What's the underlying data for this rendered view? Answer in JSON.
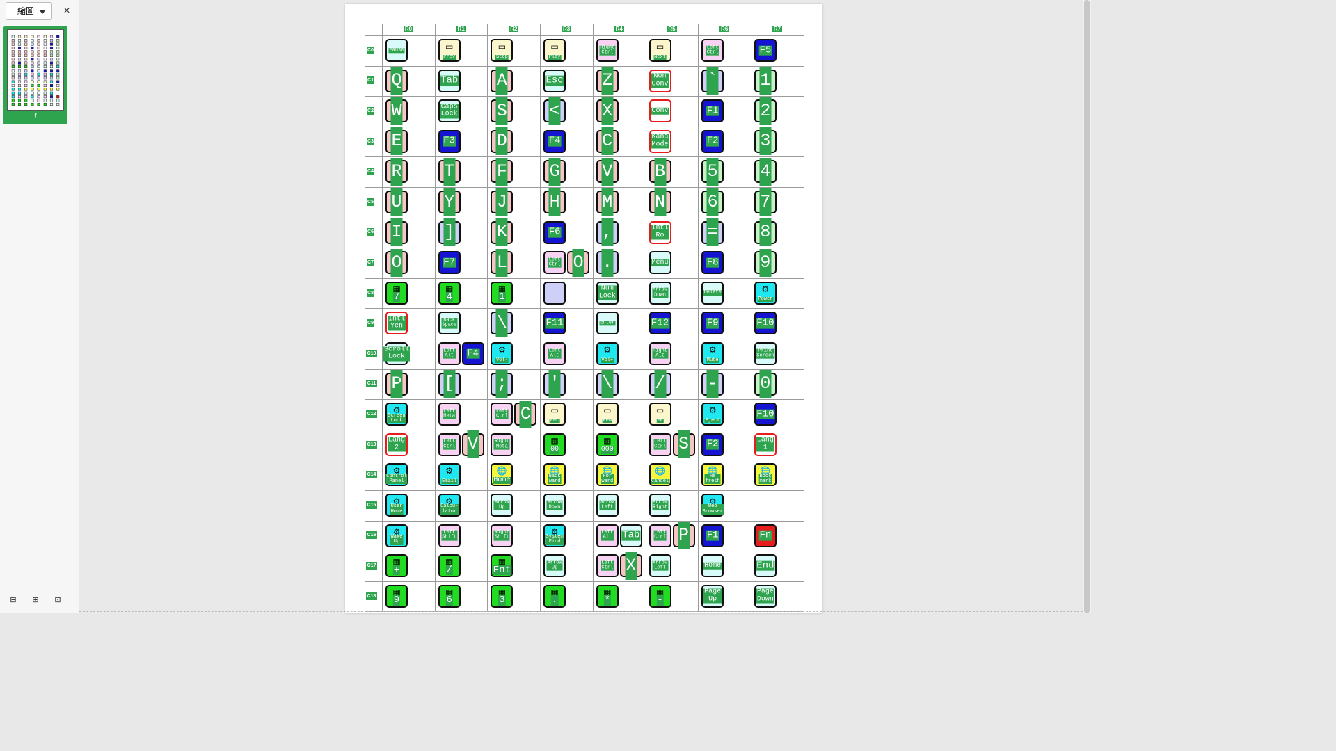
{
  "sidebar": {
    "select_label": "縮圖",
    "close_label": "×",
    "thumb_page": "1",
    "tools": [
      "⊟",
      "⊞",
      "⊡"
    ]
  },
  "colors": {
    "accent": "#2ea44f",
    "cyan": "#1fe8f0",
    "yellow": "#f6f73c",
    "green_bright": "#22dc22",
    "blue": "#1414d2",
    "red": "#e51d1d",
    "pink": "#f6c6c6",
    "lightcyan": "#d8fbfa",
    "lavender": "#cfd0f8",
    "lightgreen": "#c6f2c6",
    "cream": "#fbf6cc",
    "lightpink": "#f8d2f3",
    "white": "#ffffff"
  },
  "icons": {
    "gear": "⚙",
    "globe": "🌐",
    "keypad": "▦",
    "tape": "▭"
  },
  "columns": [
    "R0",
    "R1",
    "R2",
    "R3",
    "R4",
    "R5",
    "R6",
    "R7"
  ],
  "rows": [
    "C0",
    "C1",
    "C2",
    "C3",
    "C4",
    "C5",
    "C6",
    "C7",
    "C8",
    "C9",
    "C10",
    "C11",
    "C12",
    "C13",
    "C14",
    "C15",
    "C16",
    "C17",
    "C18"
  ],
  "matrix": [
    [
      {
        "label": "Pause",
        "color": "lightcyan",
        "size": "s4"
      },
      {
        "label": "Prev",
        "color": "cream",
        "icon": "tape",
        "size": "s4"
      },
      {
        "label": "Stop",
        "color": "cream",
        "icon": "tape",
        "size": "s4"
      },
      {
        "label": "Play",
        "color": "cream",
        "icon": "tape",
        "size": "s4"
      },
      {
        "label": "Right\nCtrl",
        "color": "lightpink",
        "size": "s4"
      },
      {
        "label": "Next",
        "color": "cream",
        "icon": "tape",
        "size": "s4"
      },
      {
        "label": "Left\nCtrl",
        "color": "lightpink",
        "size": "s4"
      },
      {
        "label": "F5",
        "color": "blue",
        "size": "s2"
      }
    ],
    [
      {
        "label": "Q",
        "color": "pink",
        "size": "s1"
      },
      {
        "label": "Tab",
        "color": "lightcyan",
        "size": "s2"
      },
      {
        "label": "A",
        "color": "pink",
        "size": "s1"
      },
      {
        "label": "Esc",
        "color": "lightcyan",
        "size": "s2"
      },
      {
        "label": "Z",
        "color": "pink",
        "size": "s1"
      },
      {
        "label": "Non\nConv",
        "color": "white",
        "size": "s3",
        "red": true
      },
      {
        "label": "`",
        "color": "lavender",
        "size": "s1"
      },
      {
        "label": "1",
        "color": "lightgreen",
        "size": "s1"
      }
    ],
    [
      {
        "label": "W",
        "color": "pink",
        "size": "s1"
      },
      {
        "label": "Caps\nLock",
        "color": "lightcyan",
        "size": "s3"
      },
      {
        "label": "S",
        "color": "pink",
        "size": "s1"
      },
      {
        "label": "<",
        "color": "lavender",
        "size": "s1"
      },
      {
        "label": "X",
        "color": "pink",
        "size": "s1"
      },
      {
        "label": "Conv",
        "color": "white",
        "size": "s3",
        "red": true
      },
      {
        "label": "F1",
        "color": "blue",
        "size": "s2"
      },
      {
        "label": "2",
        "color": "lightgreen",
        "size": "s1"
      }
    ],
    [
      {
        "label": "E",
        "color": "pink",
        "size": "s1"
      },
      {
        "label": "F3",
        "color": "blue",
        "size": "s2"
      },
      {
        "label": "D",
        "color": "pink",
        "size": "s1"
      },
      {
        "label": "F4",
        "color": "blue",
        "size": "s2"
      },
      {
        "label": "C",
        "color": "pink",
        "size": "s1"
      },
      {
        "label": "Kana\nMode",
        "color": "white",
        "size": "s3",
        "red": true
      },
      {
        "label": "F2",
        "color": "blue",
        "size": "s2"
      },
      {
        "label": "3",
        "color": "lightgreen",
        "size": "s1"
      }
    ],
    [
      {
        "label": "R",
        "color": "pink",
        "size": "s1"
      },
      {
        "label": "T",
        "color": "pink",
        "size": "s1"
      },
      {
        "label": "F",
        "color": "pink",
        "size": "s1"
      },
      {
        "label": "G",
        "color": "pink",
        "size": "s1"
      },
      {
        "label": "V",
        "color": "pink",
        "size": "s1"
      },
      {
        "label": "B",
        "color": "pink",
        "size": "s1"
      },
      {
        "label": "5",
        "color": "lightgreen",
        "size": "s1"
      },
      {
        "label": "4",
        "color": "lightgreen",
        "size": "s1"
      }
    ],
    [
      {
        "label": "U",
        "color": "pink",
        "size": "s1"
      },
      {
        "label": "Y",
        "color": "pink",
        "size": "s1"
      },
      {
        "label": "J",
        "color": "pink",
        "size": "s1"
      },
      {
        "label": "H",
        "color": "pink",
        "size": "s1"
      },
      {
        "label": "M",
        "color": "pink",
        "size": "s1"
      },
      {
        "label": "N",
        "color": "pink",
        "size": "s1"
      },
      {
        "label": "6",
        "color": "lightgreen",
        "size": "s1"
      },
      {
        "label": "7",
        "color": "lightgreen",
        "size": "s1"
      }
    ],
    [
      {
        "label": "I",
        "color": "pink",
        "size": "s1"
      },
      {
        "label": "]",
        "color": "lavender",
        "size": "s1"
      },
      {
        "label": "K",
        "color": "pink",
        "size": "s1"
      },
      {
        "label": "F6",
        "color": "blue",
        "size": "s2"
      },
      {
        "label": ",",
        "color": "lavender",
        "size": "s1"
      },
      {
        "label": "Intl\nRo",
        "color": "white",
        "size": "s3",
        "red": true
      },
      {
        "label": "=",
        "color": "lavender",
        "size": "s1"
      },
      {
        "label": "8",
        "color": "lightgreen",
        "size": "s1"
      }
    ],
    [
      {
        "label": "O",
        "color": "pink",
        "size": "s1"
      },
      {
        "label": "F7",
        "color": "blue",
        "size": "s2"
      },
      {
        "label": "L",
        "color": "pink",
        "size": "s1"
      },
      {
        "label": "Left\nCtrl",
        "color": "lightpink",
        "size": "s4",
        "extra": {
          "label": "O",
          "color": "pink"
        }
      },
      {
        "label": ".",
        "color": "lavender",
        "size": "s1"
      },
      {
        "label": "Menu",
        "color": "lightcyan",
        "size": "s3"
      },
      {
        "label": "F8",
        "color": "blue",
        "size": "s2"
      },
      {
        "label": "9",
        "color": "lightgreen",
        "size": "s1"
      }
    ],
    [
      {
        "label": "7",
        "color": "green_bright",
        "icon": "keypad",
        "size": "s2"
      },
      {
        "label": "4",
        "color": "green_bright",
        "icon": "keypad",
        "size": "s2"
      },
      {
        "label": "1",
        "color": "green_bright",
        "icon": "keypad",
        "size": "s2"
      },
      {
        "label": "",
        "color": "lavender",
        "size": "s2"
      },
      {
        "label": "Num\nLock",
        "color": "lightcyan",
        "size": "s3"
      },
      {
        "label": "Arrow\nDown",
        "color": "lightcyan",
        "size": "s4"
      },
      {
        "label": "Delete",
        "color": "lightcyan",
        "size": "s4"
      },
      {
        "label": "Power",
        "color": "cyan",
        "icon": "gear",
        "size": "s4"
      }
    ],
    [
      {
        "label": "Intl\nYen",
        "color": "white",
        "size": "s3",
        "red": true
      },
      {
        "label": "Back\nSpace",
        "color": "lightcyan",
        "size": "s4"
      },
      {
        "label": "\\",
        "color": "lavender",
        "size": "s1"
      },
      {
        "label": "F11",
        "color": "blue",
        "size": "s2"
      },
      {
        "label": "Enter",
        "color": "lightcyan",
        "size": "s4"
      },
      {
        "label": "F12",
        "color": "blue",
        "size": "s2"
      },
      {
        "label": "F9",
        "color": "blue",
        "size": "s2"
      },
      {
        "label": "F10",
        "color": "blue",
        "size": "s2"
      }
    ],
    [
      {
        "label": "Scroll\nLock",
        "color": "lightcyan",
        "size": "s3"
      },
      {
        "label": "Left\nAlt",
        "color": "lightpink",
        "size": "s4",
        "extra": {
          "label": "F4",
          "color": "blue"
        }
      },
      {
        "label": "Vol-",
        "color": "cyan",
        "icon": "gear",
        "size": "s4"
      },
      {
        "label": "Left\nAlt",
        "color": "lightpink",
        "size": "s4"
      },
      {
        "label": "Vol+",
        "color": "cyan",
        "icon": "gear",
        "size": "s4"
      },
      {
        "label": "Right\nAlt",
        "color": "lightpink",
        "size": "s4"
      },
      {
        "label": "Mute",
        "color": "cyan",
        "icon": "gear",
        "size": "s4"
      },
      {
        "label": "Print\nScreen",
        "color": "lightcyan",
        "size": "s4"
      }
    ],
    [
      {
        "label": "P",
        "color": "pink",
        "size": "s1"
      },
      {
        "label": "[",
        "color": "lavender",
        "size": "s1"
      },
      {
        "label": ";",
        "color": "lavender",
        "size": "s1"
      },
      {
        "label": "'",
        "color": "lavender",
        "size": "s1"
      },
      {
        "label": "\\",
        "color": "lavender",
        "size": "s1"
      },
      {
        "label": "/",
        "color": "lavender",
        "size": "s1"
      },
      {
        "label": "-",
        "color": "lavender",
        "size": "s1"
      },
      {
        "label": "0",
        "color": "lightgreen",
        "size": "s1"
      }
    ],
    [
      {
        "label": "Screen\nLock",
        "color": "cyan",
        "icon": "gear",
        "size": "s4"
      },
      {
        "label": "Left\nMeta",
        "color": "lightpink",
        "size": "s4"
      },
      {
        "label": "Left\nCtrl",
        "color": "lightpink",
        "size": "s4",
        "extra": {
          "label": "C",
          "color": "pink"
        }
      },
      {
        "label": "Rec",
        "color": "cream",
        "icon": "tape",
        "size": "s4"
      },
      {
        "label": "Rew",
        "color": "cream",
        "icon": "tape",
        "size": "s4"
      },
      {
        "label": "FF",
        "color": "cream",
        "icon": "tape",
        "size": "s4"
      },
      {
        "label": "Eject",
        "color": "cyan",
        "icon": "gear",
        "size": "s4"
      },
      {
        "label": "F10",
        "color": "blue",
        "size": "s2"
      }
    ],
    [
      {
        "label": "Lang\n2",
        "color": "white",
        "size": "s3",
        "red": true
      },
      {
        "label": "Left\nCtrl",
        "color": "lightpink",
        "size": "s4",
        "extra": {
          "label": "V",
          "color": "pink"
        }
      },
      {
        "label": "Right\nMeta",
        "color": "lightpink",
        "size": "s4"
      },
      {
        "label": "00",
        "color": "green_bright",
        "icon": "keypad",
        "size": "s3"
      },
      {
        "label": "000",
        "color": "green_bright",
        "icon": "keypad",
        "size": "s3"
      },
      {
        "label": "Left\nCtrl",
        "color": "lightpink",
        "size": "s4",
        "extra": {
          "label": "S",
          "color": "pink"
        }
      },
      {
        "label": "F2",
        "color": "blue",
        "size": "s2"
      },
      {
        "label": "Lang\n1",
        "color": "white",
        "size": "s3",
        "red": true
      }
    ],
    [
      {
        "label": "Control\nPanel",
        "color": "cyan",
        "icon": "gear",
        "size": "s4"
      },
      {
        "label": "Email",
        "color": "cyan",
        "icon": "gear",
        "size": "s4"
      },
      {
        "label": "Home",
        "color": "yellow",
        "icon": "globe",
        "size": "s3"
      },
      {
        "label": "Back\nward",
        "color": "yellow",
        "icon": "globe",
        "size": "s4"
      },
      {
        "label": "For\nward",
        "color": "yellow",
        "icon": "globe",
        "size": "s4"
      },
      {
        "label": "Cancel",
        "color": "yellow",
        "icon": "globe",
        "size": "s4"
      },
      {
        "label": "Re\nfresh",
        "color": "yellow",
        "icon": "globe",
        "size": "s4"
      },
      {
        "label": "Book\nmark",
        "color": "yellow",
        "icon": "globe",
        "size": "s4"
      }
    ],
    [
      {
        "label": "User\nHome",
        "color": "cyan",
        "icon": "gear",
        "size": "s4"
      },
      {
        "label": "Calcu-\nlator",
        "color": "cyan",
        "icon": "gear",
        "size": "s4"
      },
      {
        "label": "Arrow\nUp",
        "color": "lightcyan",
        "size": "s4"
      },
      {
        "label": "Arrow\nDown",
        "color": "lightcyan",
        "size": "s4"
      },
      {
        "label": "Arrow\nLeft",
        "color": "lightcyan",
        "size": "s4"
      },
      {
        "label": "Arrow\nRight",
        "color": "lightcyan",
        "size": "s4"
      },
      {
        "label": "Web\nBrowser",
        "color": "cyan",
        "icon": "gear",
        "size": "s4"
      },
      null
    ],
    [
      {
        "label": "Wake\nUp",
        "color": "cyan",
        "icon": "gear",
        "size": "s4"
      },
      {
        "label": "Left\nShift",
        "color": "lightpink",
        "size": "s4"
      },
      {
        "label": "Right\nShift",
        "color": "lightpink",
        "size": "s4"
      },
      {
        "label": "System\nFind",
        "color": "cyan",
        "icon": "gear",
        "size": "s4"
      },
      {
        "label": "Left\nAlt",
        "color": "lightpink",
        "size": "s4",
        "extra": {
          "label": "Tab",
          "color": "lightcyan"
        }
      },
      {
        "label": "Left\nCtrl",
        "color": "lightpink",
        "size": "s4",
        "extra": {
          "label": "P",
          "color": "pink"
        }
      },
      {
        "label": "F1",
        "color": "blue",
        "size": "s2"
      },
      {
        "label": "Fn",
        "color": "red",
        "size": "s2"
      }
    ],
    [
      {
        "label": "+",
        "color": "green_bright",
        "icon": "keypad",
        "size": "s2"
      },
      {
        "label": "/",
        "color": "green_bright",
        "icon": "keypad",
        "size": "s2"
      },
      {
        "label": "Ent",
        "color": "green_bright",
        "icon": "keypad",
        "size": "s2"
      },
      {
        "label": "Arrow\nUp",
        "color": "lightcyan",
        "size": "s4"
      },
      {
        "label": "Left\nCtrl",
        "color": "lightpink",
        "size": "s4",
        "extra": {
          "label": "X",
          "color": "pink"
        }
      },
      {
        "label": "Arrow\nLeft",
        "color": "lightcyan",
        "size": "s4"
      },
      {
        "label": "Home",
        "color": "lightcyan",
        "size": "s3"
      },
      {
        "label": "End",
        "color": "lightcyan",
        "size": "s2"
      }
    ],
    [
      {
        "label": "9",
        "color": "green_bright",
        "icon": "keypad",
        "size": "s2"
      },
      {
        "label": "6",
        "color": "green_bright",
        "icon": "keypad",
        "size": "s2"
      },
      {
        "label": "3",
        "color": "green_bright",
        "icon": "keypad",
        "size": "s2"
      },
      {
        "label": ".",
        "color": "green_bright",
        "icon": "keypad",
        "size": "s2"
      },
      {
        "label": "*",
        "color": "green_bright",
        "icon": "keypad",
        "size": "s2"
      },
      {
        "label": "-",
        "color": "green_bright",
        "icon": "keypad",
        "size": "s2"
      },
      {
        "label": "Page\nUp",
        "color": "lightcyan",
        "size": "s3"
      },
      {
        "label": "Page\nDown",
        "color": "lightcyan",
        "size": "s3"
      }
    ]
  ]
}
